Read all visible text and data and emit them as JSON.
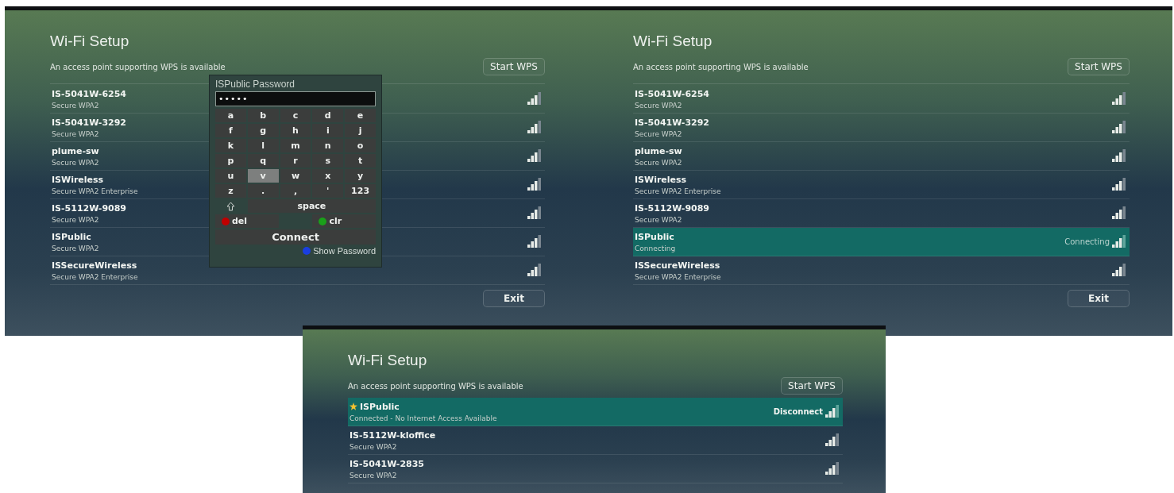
{
  "panels": [
    {
      "title": "Wi-Fi Setup",
      "subtitle": "An access point supporting WPS is available",
      "wps_button": "Start WPS",
      "exit_button": "Exit",
      "networks": [
        {
          "name": "IS-5041W-6254",
          "detail": "Secure WPA2",
          "selected": false
        },
        {
          "name": "IS-5041W-3292",
          "detail": "Secure WPA2",
          "selected": false
        },
        {
          "name": "plume-sw",
          "detail": "Secure WPA2",
          "selected": false
        },
        {
          "name": "ISWireless",
          "detail": "Secure WPA2 Enterprise",
          "selected": false
        },
        {
          "name": "IS-5112W-9089",
          "detail": "Secure WPA2",
          "selected": false
        },
        {
          "name": "ISPublic",
          "detail": "Secure WPA2",
          "selected": false
        },
        {
          "name": "ISSecureWireless",
          "detail": "Secure WPA2 Enterprise",
          "selected": false
        }
      ],
      "password_dialog": {
        "title": "ISPublic Password",
        "value": "•••••",
        "keys": [
          {
            "label": "a",
            "selected": false
          },
          {
            "label": "b",
            "selected": false
          },
          {
            "label": "c",
            "selected": false
          },
          {
            "label": "d",
            "selected": false
          },
          {
            "label": "e",
            "selected": false
          },
          {
            "label": "f",
            "selected": false
          },
          {
            "label": "g",
            "selected": false
          },
          {
            "label": "h",
            "selected": false
          },
          {
            "label": "i",
            "selected": false
          },
          {
            "label": "j",
            "selected": false
          },
          {
            "label": "k",
            "selected": false
          },
          {
            "label": "l",
            "selected": false
          },
          {
            "label": "m",
            "selected": false
          },
          {
            "label": "n",
            "selected": false
          },
          {
            "label": "o",
            "selected": false
          },
          {
            "label": "p",
            "selected": false
          },
          {
            "label": "q",
            "selected": false
          },
          {
            "label": "r",
            "selected": false
          },
          {
            "label": "s",
            "selected": false
          },
          {
            "label": "t",
            "selected": false
          },
          {
            "label": "u",
            "selected": false
          },
          {
            "label": "v",
            "selected": true
          },
          {
            "label": "w",
            "selected": false
          },
          {
            "label": "x",
            "selected": false
          },
          {
            "label": "y",
            "selected": false
          },
          {
            "label": "z",
            "selected": false
          },
          {
            "label": ".",
            "selected": false
          },
          {
            "label": ",",
            "selected": false
          },
          {
            "label": "'",
            "selected": false
          },
          {
            "label": "123",
            "selected": false
          }
        ],
        "space_key": "space",
        "del_key": {
          "label": "del",
          "color": "#c00000"
        },
        "clr_key": {
          "label": "clr",
          "color": "#1aa01a"
        },
        "connect_button": "Connect",
        "show_password": {
          "label": "Show Password",
          "color": "#1a3ee0"
        }
      }
    },
    {
      "title": "Wi-Fi Setup",
      "subtitle": "An access point supporting WPS is available",
      "wps_button": "Start WPS",
      "exit_button": "Exit",
      "networks": [
        {
          "name": "IS-5041W-6254",
          "detail": "Secure WPA2",
          "selected": false
        },
        {
          "name": "IS-5041W-3292",
          "detail": "Secure WPA2",
          "selected": false
        },
        {
          "name": "plume-sw",
          "detail": "Secure WPA2",
          "selected": false
        },
        {
          "name": "ISWireless",
          "detail": "Secure WPA2 Enterprise",
          "selected": false
        },
        {
          "name": "IS-5112W-9089",
          "detail": "Secure WPA2",
          "selected": false
        },
        {
          "name": "ISPublic",
          "detail": "Connecting",
          "selected": true,
          "action": "Connecting"
        },
        {
          "name": "ISSecureWireless",
          "detail": "Secure WPA2 Enterprise",
          "selected": false
        }
      ]
    },
    {
      "title": "Wi-Fi Setup",
      "subtitle": "An access point supporting WPS is available",
      "wps_button": "Start WPS",
      "networks": [
        {
          "name": "ISPublic",
          "detail": "Connected - No Internet Access Available",
          "selected": true,
          "favorite": true,
          "action": "Disconnect"
        },
        {
          "name": "IS-5112W-kloffice",
          "detail": "Secure WPA2",
          "selected": false
        },
        {
          "name": "IS-5041W-2835",
          "detail": "Secure WPA2",
          "selected": false
        }
      ]
    }
  ]
}
